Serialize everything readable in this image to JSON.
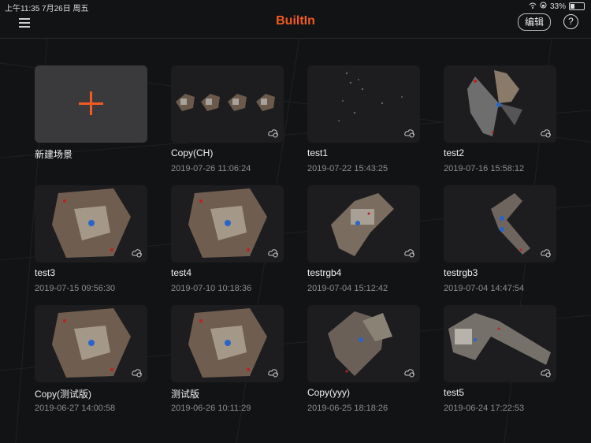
{
  "status_bar": {
    "time_date": "上午11:35   7月26日 周五",
    "battery": "33%"
  },
  "header": {
    "title": "BuiltIn",
    "edit_label": "编辑",
    "help_label": "?"
  },
  "scenes": [
    {
      "name": "新建场景",
      "date": "",
      "type": "new"
    },
    {
      "name": "Copy(CH)",
      "date": "2019-07-26 11:06:24",
      "type": "multi"
    },
    {
      "name": "test1",
      "date": "2019-07-22 15:43:25",
      "type": "sparse"
    },
    {
      "name": "test2",
      "date": "2019-07-16 15:58:12",
      "type": "fan"
    },
    {
      "name": "test3",
      "date": "2019-07-15 09:56:30",
      "type": "blob"
    },
    {
      "name": "test4",
      "date": "2019-07-10 10:18:36",
      "type": "blob"
    },
    {
      "name": "testrgb4",
      "date": "2019-07-04 15:12:42",
      "type": "plan"
    },
    {
      "name": "testrgb3",
      "date": "2019-07-04 14:47:54",
      "type": "corridor"
    },
    {
      "name": "Copy(测试版)",
      "date": "2019-06-27 14:00:58",
      "type": "blob"
    },
    {
      "name": "测试版",
      "date": "2019-06-26 10:11:29",
      "type": "blob"
    },
    {
      "name": "Copy(yyy)",
      "date": "2019-06-25 18:18:26",
      "type": "scatter"
    },
    {
      "name": "test5",
      "date": "2019-06-24 17:22:53",
      "type": "long"
    }
  ],
  "colors": {
    "accent": "#f15a22",
    "background": "#121315",
    "card": "#1d1d1f"
  }
}
